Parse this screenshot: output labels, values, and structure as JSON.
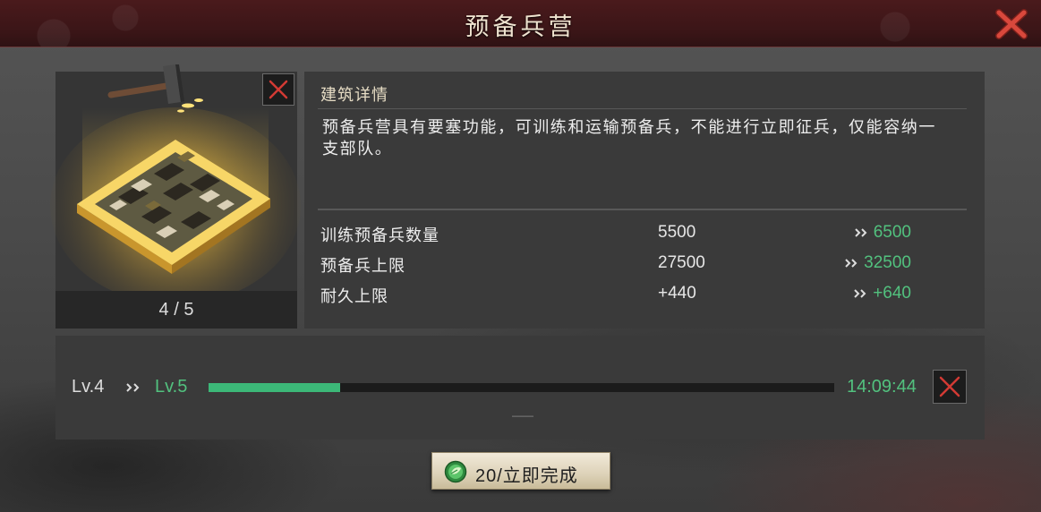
{
  "header": {
    "title": "预备兵营",
    "close_icon": "close-x-icon"
  },
  "building": {
    "level_progress": "4 / 5",
    "remove_icon": "close-x-icon"
  },
  "details": {
    "title": "建筑详情",
    "description_lines": [
      "预备兵营具有要塞功能，可训练和运输预备兵，不能进行立即征兵，仅能容纳一",
      "支部队。"
    ],
    "stats": [
      {
        "label": "训练预备兵数量",
        "current": "5500",
        "next": "6500"
      },
      {
        "label": "预备兵上限",
        "current": "27500",
        "next": "32500"
      },
      {
        "label": "耐久上限",
        "current": "+440",
        "next": "+640"
      }
    ]
  },
  "upgrade": {
    "from_level": "Lv.4",
    "to_level": "Lv.5",
    "progress": 0.21,
    "time_remaining": "14:09:44",
    "note": "——",
    "cancel_icon": "close-x-icon"
  },
  "action": {
    "label": "20/立即完成",
    "icon": "green-gem-icon"
  },
  "colors": {
    "accent_green": "#52c17e",
    "close_red": "#c93a32",
    "header_red": "#4a1a1c"
  }
}
